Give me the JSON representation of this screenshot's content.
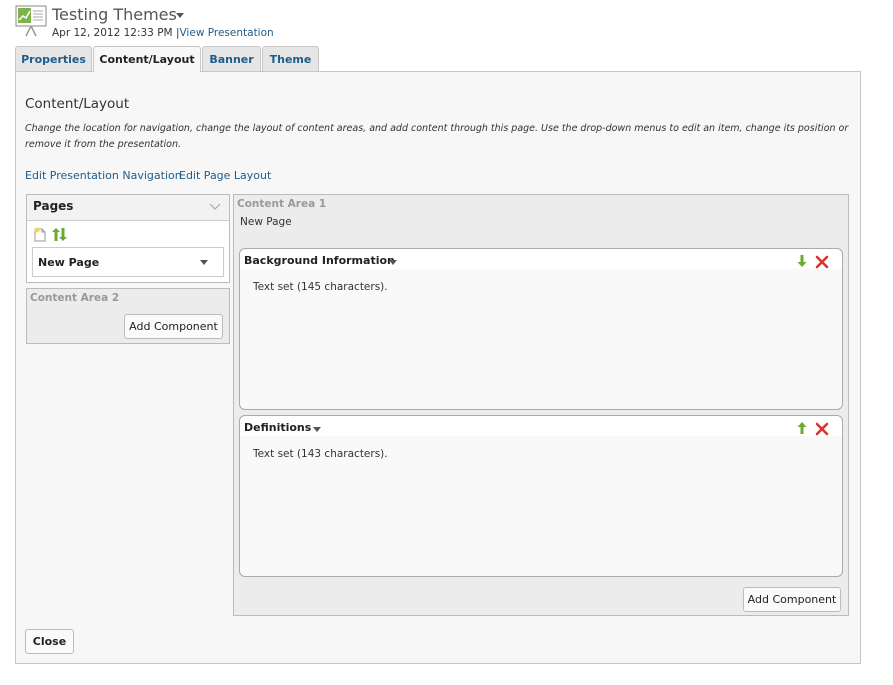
{
  "header": {
    "title": "Testing Themes",
    "date": "Apr 12, 2012 12:33 PM",
    "separator": "|",
    "view_link": "View Presentation"
  },
  "tabs": [
    {
      "label": "Properties",
      "active": false
    },
    {
      "label": "Content/Layout",
      "active": true
    },
    {
      "label": "Banner",
      "active": false
    },
    {
      "label": "Theme",
      "active": false
    }
  ],
  "main": {
    "heading": "Content/Layout",
    "description": "Change the location for navigation, change the layout of content areas, and add content through this page. Use the drop-down menus to edit an item, change its position or remove it from the presentation.",
    "links": {
      "edit_navigation": "Edit Presentation Navigation",
      "edit_layout": "Edit Page Layout"
    }
  },
  "pages_panel": {
    "title": "Pages",
    "selected_page": "New Page",
    "icons": [
      "new-page-icon",
      "reorder-icon"
    ]
  },
  "content_area_2": {
    "label": "Content Area 2",
    "add_button": "Add Component"
  },
  "content_area_1": {
    "label": "Content Area 1",
    "page_name": "New Page",
    "components": [
      {
        "title": "Background Information",
        "text": "Text set (145 characters).",
        "move_icon": "move-down-icon"
      },
      {
        "title": "Definitions",
        "text": "Text set (143 characters).",
        "move_icon": "move-up-icon"
      }
    ],
    "add_button": "Add Component"
  },
  "footer": {
    "close_button": "Close"
  },
  "colors": {
    "link": "#1f5c8a",
    "move_arrow": "#6aab2e",
    "delete": "#d9342b"
  }
}
